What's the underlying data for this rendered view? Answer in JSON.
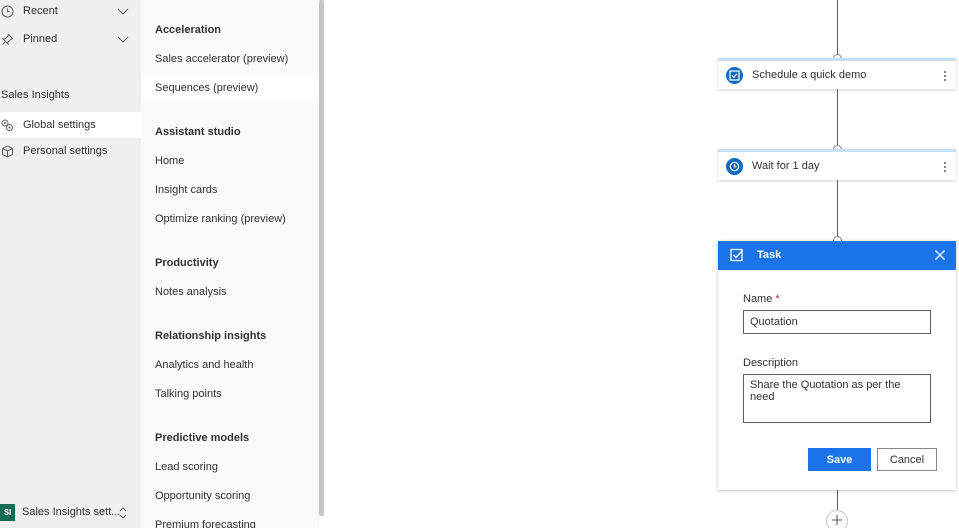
{
  "leftnav": {
    "recent_label": "Recent",
    "pinned_label": "Pinned",
    "group_title": "Sales Insights",
    "global_settings_label": "Global settings",
    "personal_settings_label": "Personal settings",
    "area_badge": "SI",
    "area_label": "Sales Insights sett..."
  },
  "settings": {
    "acceleration_header": "Acceleration",
    "sales_accelerator": "Sales accelerator (preview)",
    "sequences": "Sequences (preview)",
    "assistant_header": "Assistant studio",
    "home": "Home",
    "insight_cards": "Insight cards",
    "optimize_ranking": "Optimize ranking (preview)",
    "productivity_header": "Productivity",
    "notes_analysis": "Notes analysis",
    "relationship_header": "Relationship insights",
    "analytics_health": "Analytics and health",
    "talking_points": "Talking points",
    "predictive_header": "Predictive models",
    "lead_scoring": "Lead scoring",
    "opportunity_scoring": "Opportunity scoring",
    "premium_forecasting": "Premium forecasting"
  },
  "canvas": {
    "step1_label": "Schedule a quick demo",
    "step2_label": "Wait for 1 day"
  },
  "task": {
    "title": "Task",
    "name_label": "Name",
    "required_mark": "*",
    "name_value": "Quotation",
    "description_label": "Description",
    "description_value": "Share the Quotation as per the need",
    "save_label": "Save",
    "cancel_label": "Cancel"
  },
  "colors": {
    "accent": "#1a73e8",
    "area_badge_bg": "#146c55"
  }
}
